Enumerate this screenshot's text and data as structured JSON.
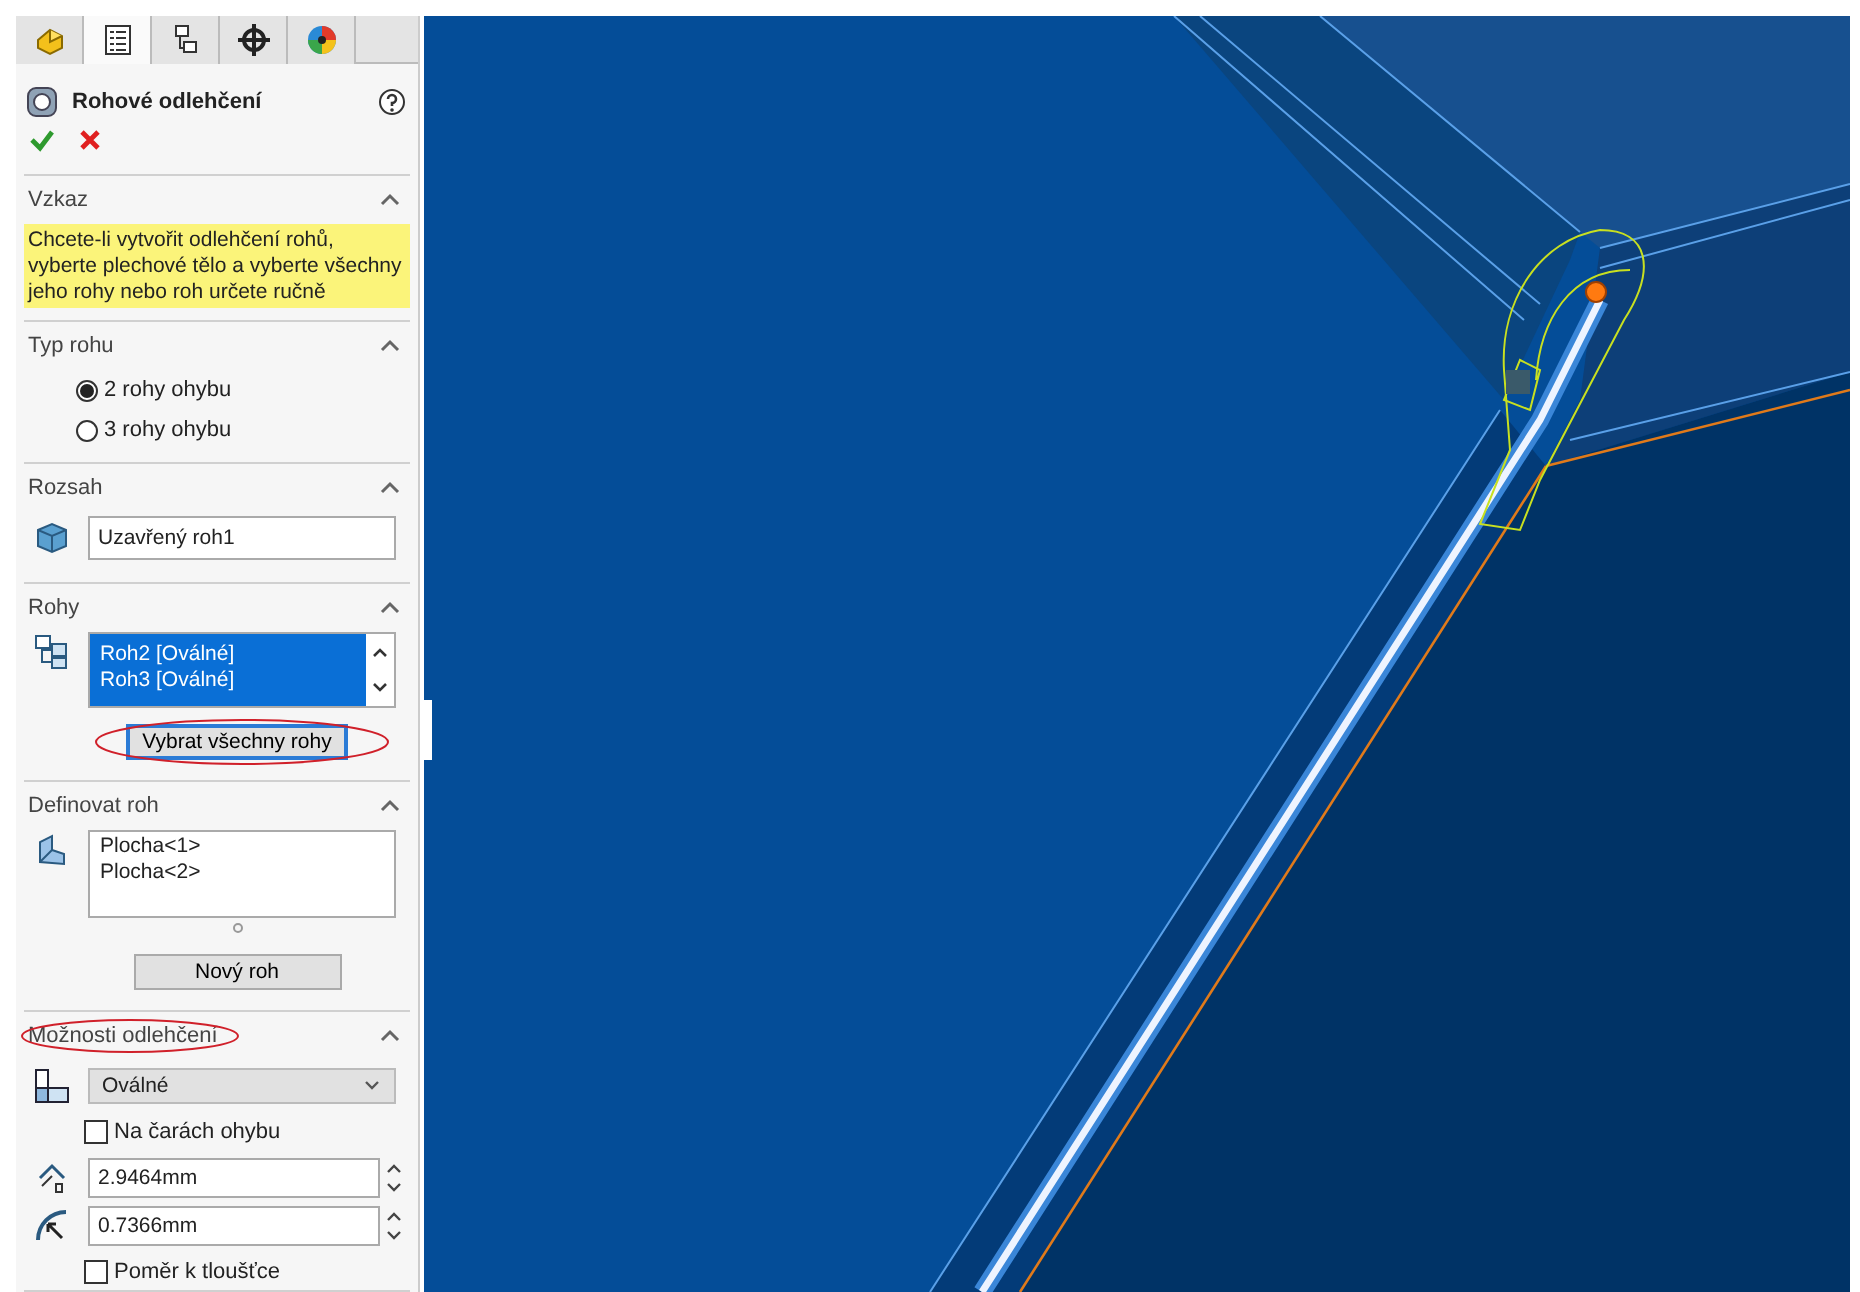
{
  "tabs": [
    {
      "kind": "features",
      "selected": false
    },
    {
      "kind": "properties",
      "selected": true
    },
    {
      "kind": "configuration",
      "selected": false
    },
    {
      "kind": "dimxpert",
      "selected": false
    },
    {
      "kind": "display",
      "selected": false
    }
  ],
  "panel": {
    "title": "Rohové odlehčení"
  },
  "sections": [
    {
      "kind": "message",
      "title": "Vzkaz",
      "expanded": true,
      "text": "Chcete-li vytvořit odlehčení rohů, vyberte plechové tělo a vyberte všechny jeho rohy nebo roh určete ručně"
    },
    {
      "kind": "radios",
      "title": "Typ rohu",
      "expanded": true,
      "options": [
        {
          "label": "2 rohy ohybu",
          "selected": true
        },
        {
          "label": "3 rohy ohybu",
          "selected": false
        }
      ]
    },
    {
      "kind": "field",
      "title": "Rozsah",
      "expanded": true,
      "value": "Uzavřený roh1"
    },
    {
      "kind": "corner-list",
      "title": "Rohy",
      "expanded": true,
      "items": [
        {
          "label": "Roh2 [Oválné]",
          "selected": true
        },
        {
          "label": "Roh3 [Oválné]",
          "selected": true
        }
      ],
      "button": {
        "label": "Vybrat všechny rohy",
        "circled": true,
        "focused": true
      }
    },
    {
      "kind": "face-list",
      "title": "Definovat roh",
      "expanded": true,
      "items": [
        {
          "label": "Plocha<1>",
          "selected": false
        },
        {
          "label": "Plocha<2>",
          "selected": false
        }
      ],
      "button": {
        "label": "Nový roh",
        "circled": false,
        "focused": false
      }
    },
    {
      "kind": "options",
      "title": "Možnosti odlehčení",
      "title_circled": true,
      "expanded": true,
      "controls": [
        {
          "kind": "dropdown",
          "value": "Oválné"
        },
        {
          "kind": "checkbox",
          "label": "Na čarách ohybu",
          "checked": false
        },
        {
          "kind": "spinner",
          "value": "2.9464mm"
        },
        {
          "kind": "spinner",
          "value": "0.7366mm"
        },
        {
          "kind": "checkbox",
          "label": "Poměr k tloušťce",
          "checked": false
        }
      ]
    }
  ]
}
